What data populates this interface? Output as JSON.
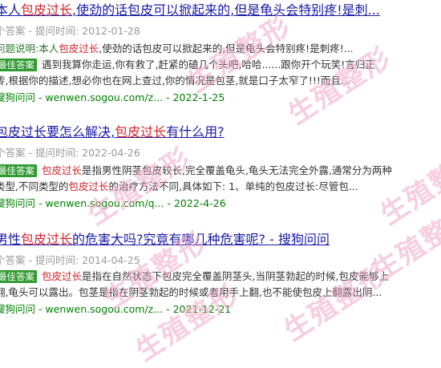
{
  "results": [
    {
      "title_a": "本人",
      "title_hl": "包皮过长",
      "title_b": ",使劲的话包皮可以掀起来的,但是龟头会特别疼!是刺...",
      "meta": "个答案 - 提问时间: 2012-01-28",
      "line1_prefix": "问题说明:本人",
      "line1_hl": "包皮过长",
      "line1_rest": ",使劲的话包皮可以掀起来的,但是龟头会特别疼!是刺疼!...",
      "badge": "最佳答案",
      "line2": "遇到我算你走运,你有救了,赶紧的磕几个头吧,哈哈......跟你开个玩笑!言归正",
      "line3": "传,根据你的描述,想必你也在网上查过,你的情况是包茎,就是口子太窄了!!!而且...",
      "source": "搜狗问问 - wenwen.sogou.com/z... - 2022-1-25"
    },
    {
      "title_a": "包皮过长要怎么解决,",
      "title_hl": "包皮过长",
      "title_b": "有什么用?",
      "meta": "个答案 - 提问时间: 2022-04-26",
      "badge": "最佳答案",
      "line1_hl": "包皮过长",
      "line1_rest": "是指男性阴茎包皮较长,完全覆盖龟头,龟头无法完全外露,通常分为两种",
      "line2_a": "类型,不同类型的",
      "line2_hl": "包皮过长",
      "line2_b": "的治疗方法不同,具体如下: 1、单纯的包皮过长:尽管包...",
      "source": "搜狗问问 - wenwen.sogou.com/q... - 2022-4-26"
    },
    {
      "title_a": "男性",
      "title_hl": "包皮过长",
      "title_b": "的危害大吗?究竟有哪几种危害呢? - 搜狗问问",
      "meta": "个答案 - 提问时间: 2014-04-25",
      "badge": "最佳答案",
      "line1_hl": "包皮过长",
      "line1_rest": "是指在自然状态下包皮完全覆盖阴茎头,当阴茎勃起的时候,包皮能够上",
      "line2": "翻,龟头可以露出。包茎是指在阴茎勃起的时候或者用手上翻,也不能使包皮上翻露出阴...",
      "source": "搜狗问问 - wenwen.sogou.com/z... - 2021-12-21"
    }
  ],
  "watermark_text": "生殖整形",
  "colors": {
    "link": "#1a1aa6",
    "highlight": "#d4222b",
    "badge": "#2f9a2f",
    "source": "#008000",
    "watermark": "#f2a7c6"
  }
}
